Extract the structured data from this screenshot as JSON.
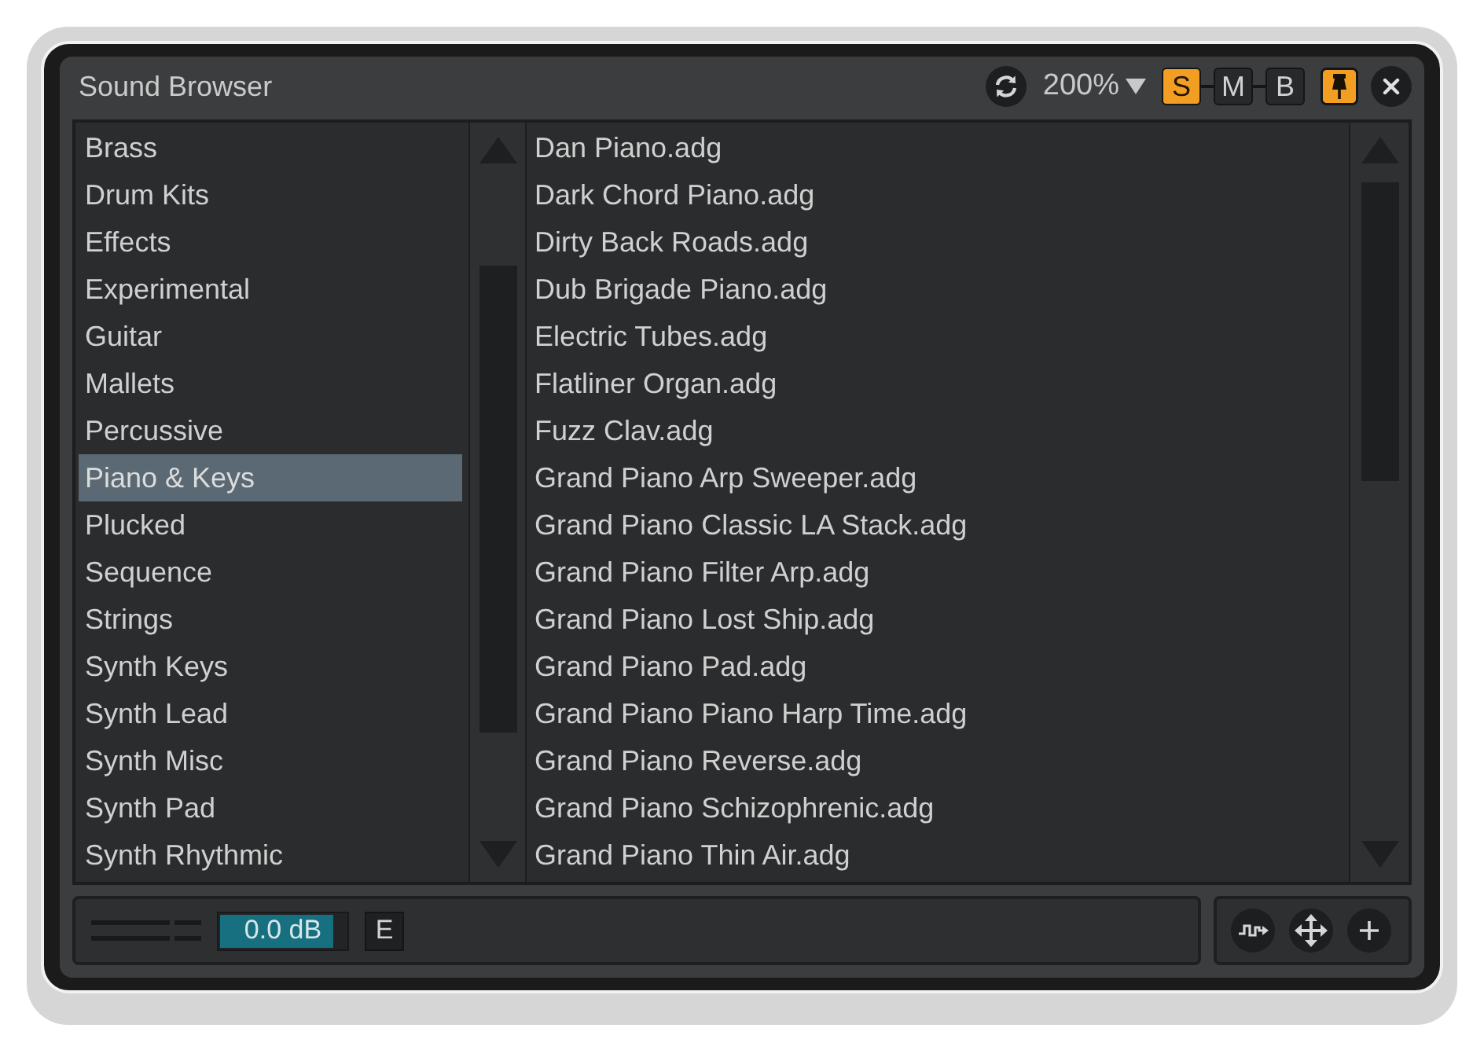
{
  "window": {
    "title": "Sound Browser"
  },
  "toolbar": {
    "zoom": "200%",
    "modes": [
      {
        "label": "S",
        "on": true
      },
      {
        "label": "M",
        "on": false
      },
      {
        "label": "B",
        "on": false
      }
    ],
    "pin": {
      "on": true
    }
  },
  "categories": [
    {
      "label": "Brass",
      "selected": false
    },
    {
      "label": "Drum Kits",
      "selected": false
    },
    {
      "label": "Effects",
      "selected": false
    },
    {
      "label": "Experimental",
      "selected": false
    },
    {
      "label": "Guitar",
      "selected": false
    },
    {
      "label": "Mallets",
      "selected": false
    },
    {
      "label": "Percussive",
      "selected": false
    },
    {
      "label": "Piano & Keys",
      "selected": true
    },
    {
      "label": "Plucked",
      "selected": false
    },
    {
      "label": "Sequence",
      "selected": false
    },
    {
      "label": "Strings",
      "selected": false
    },
    {
      "label": "Synth Keys",
      "selected": false
    },
    {
      "label": "Synth Lead",
      "selected": false
    },
    {
      "label": "Synth Misc",
      "selected": false
    },
    {
      "label": "Synth Pad",
      "selected": false
    },
    {
      "label": "Synth Rhythmic",
      "selected": false
    }
  ],
  "files": [
    {
      "label": "Dan Piano.adg",
      "selected": false
    },
    {
      "label": "Dark Chord Piano.adg",
      "selected": false
    },
    {
      "label": "Dirty Back Roads.adg",
      "selected": false
    },
    {
      "label": "Dub Brigade Piano.adg",
      "selected": false
    },
    {
      "label": "Electric Tubes.adg",
      "selected": false
    },
    {
      "label": "Flatliner Organ.adg",
      "selected": false
    },
    {
      "label": "Fuzz Clav.adg",
      "selected": false
    },
    {
      "label": "Grand Piano Arp Sweeper.adg",
      "selected": false
    },
    {
      "label": "Grand Piano Classic LA Stack.adg",
      "selected": false
    },
    {
      "label": "Grand Piano Filter Arp.adg",
      "selected": false
    },
    {
      "label": "Grand Piano Lost Ship.adg",
      "selected": false
    },
    {
      "label": "Grand Piano Pad.adg",
      "selected": false
    },
    {
      "label": "Grand Piano Piano Harp Time.adg",
      "selected": false
    },
    {
      "label": "Grand Piano Reverse.adg",
      "selected": false
    },
    {
      "label": "Grand Piano Schizophrenic.adg",
      "selected": false
    },
    {
      "label": "Grand Piano Thin Air.adg",
      "selected": false
    }
  ],
  "bottom_bar": {
    "volume": {
      "reading": "0.0 dB",
      "level": 0.9
    },
    "e_button": {
      "label": "E"
    }
  }
}
